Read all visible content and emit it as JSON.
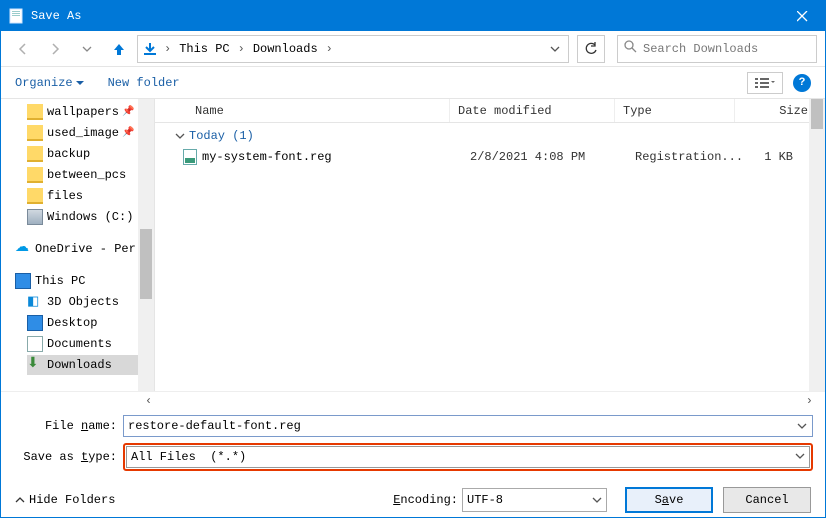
{
  "window": {
    "title": "Save As"
  },
  "nav": {
    "path_root": "This PC",
    "path_folder": "Downloads",
    "search_placeholder": "Search Downloads"
  },
  "toolbar": {
    "organize": "Organize",
    "new_folder": "New folder"
  },
  "sidebar": {
    "items": [
      {
        "name": "wallpapers",
        "icon": "folder",
        "pinned": true,
        "indent": true
      },
      {
        "name": "used_image",
        "icon": "folder",
        "pinned": true,
        "indent": true
      },
      {
        "name": "backup",
        "icon": "folder",
        "indent": true
      },
      {
        "name": "between_pcs",
        "icon": "folder",
        "indent": true
      },
      {
        "name": "files",
        "icon": "folder",
        "indent": true
      },
      {
        "name": "Windows (C:)",
        "icon": "hdd",
        "indent": true
      },
      {
        "gap": true
      },
      {
        "name": "OneDrive - Per",
        "icon": "cloud"
      },
      {
        "gap": true
      },
      {
        "name": "This PC",
        "icon": "monitor"
      },
      {
        "name": "3D Objects",
        "icon": "3d",
        "indent": true
      },
      {
        "name": "Desktop",
        "icon": "monitor",
        "indent": true
      },
      {
        "name": "Documents",
        "icon": "doc",
        "indent": true
      },
      {
        "name": "Downloads",
        "icon": "download",
        "indent": true,
        "selected": true
      }
    ]
  },
  "filelist": {
    "headers": {
      "name": "Name",
      "date": "Date modified",
      "type": "Type",
      "size": "Size"
    },
    "group_label": "Today (1)",
    "rows": [
      {
        "name": "my-system-font.reg",
        "date": "2/8/2021 4:08 PM",
        "type": "Registration...",
        "size": "1 KB"
      }
    ]
  },
  "inputs": {
    "filename_label": "File name:",
    "filename_value": "restore-default-font.reg",
    "savetype_label": "Save as type:",
    "savetype_value": "All Files  (*.*)"
  },
  "footer": {
    "hide_folders": "Hide Folders",
    "encoding_label": "Encoding:",
    "encoding_value": "UTF-8",
    "save_pre": "S",
    "save_key": "a",
    "save_post": "ve",
    "cancel": "Cancel"
  }
}
